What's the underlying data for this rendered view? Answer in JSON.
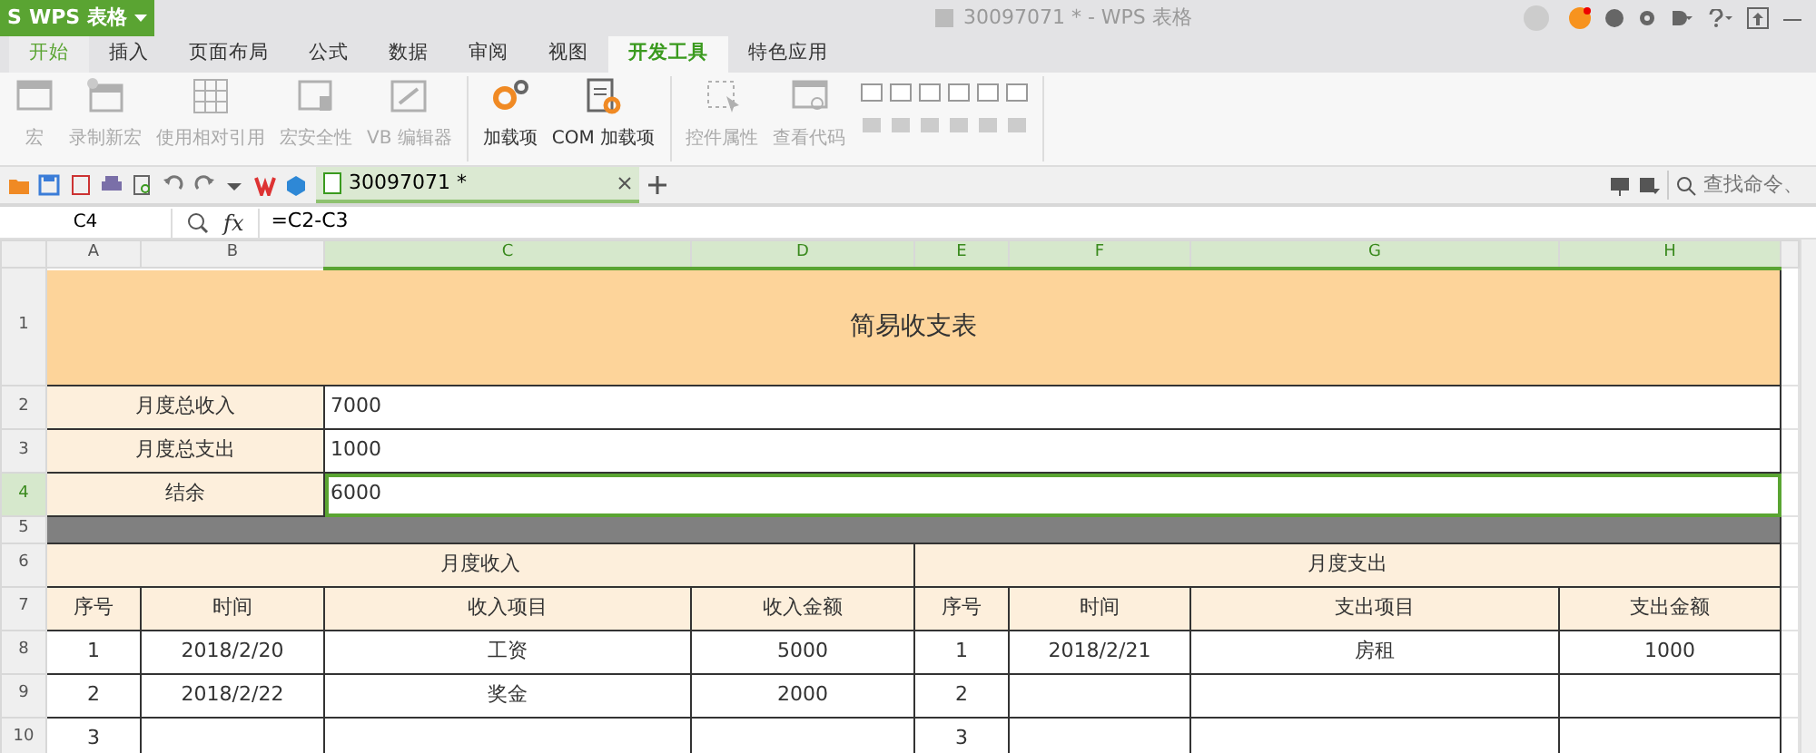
{
  "app": {
    "logo": "S",
    "name": "WPS 表格"
  },
  "window": {
    "title": "30097071 * - WPS 表格"
  },
  "menu_tabs": [
    {
      "label": "开始",
      "selected": false,
      "kind": "home"
    },
    {
      "label": "插入",
      "selected": false
    },
    {
      "label": "页面布局",
      "selected": false
    },
    {
      "label": "公式",
      "selected": false
    },
    {
      "label": "数据",
      "selected": false
    },
    {
      "label": "审阅",
      "selected": false
    },
    {
      "label": "视图",
      "selected": false
    },
    {
      "label": "开发工具",
      "selected": true
    },
    {
      "label": "特色应用",
      "selected": false
    }
  ],
  "ribbon": [
    {
      "label": "宏",
      "disabled": true,
      "kind": "window"
    },
    {
      "label": "录制新宏",
      "disabled": true,
      "kind": "record"
    },
    {
      "label": "使用相对引用",
      "disabled": true,
      "kind": "grid"
    },
    {
      "label": "宏安全性",
      "disabled": true,
      "kind": "shield"
    },
    {
      "label": "VB 编辑器",
      "disabled": true,
      "kind": "edit",
      "sep_after": true
    },
    {
      "label": "加载项",
      "disabled": false,
      "kind": "gears"
    },
    {
      "label": "COM 加载项",
      "disabled": false,
      "kind": "docgear",
      "sep_after": true
    },
    {
      "label": "控件属性",
      "disabled": true,
      "kind": "select"
    },
    {
      "label": "查看代码",
      "disabled": true,
      "kind": "code"
    }
  ],
  "document_tab": {
    "label": "30097071 *",
    "selected": true
  },
  "search": {
    "placeholder": "查找命令、"
  },
  "formula_bar": {
    "name_box": "C4",
    "fx": "fx",
    "formula": "=C2-C3"
  },
  "columns": [
    {
      "label": "A",
      "selected": false
    },
    {
      "label": "B",
      "selected": false
    },
    {
      "label": "C",
      "selected": true
    },
    {
      "label": "D",
      "selected": true
    },
    {
      "label": "E",
      "selected": true
    },
    {
      "label": "F",
      "selected": true
    },
    {
      "label": "G",
      "selected": true
    },
    {
      "label": "H",
      "selected": true
    }
  ],
  "rows": [
    {
      "number": "1",
      "selected": false,
      "kind": "tall",
      "cells": [
        {
          "text": "简易收支表",
          "kind": "title"
        }
      ]
    },
    {
      "number": "2",
      "selected": false,
      "cells": [
        {
          "text": "月度总收入",
          "kind": "label"
        },
        {
          "text": "7000",
          "kind": "value",
          "selected": false
        }
      ]
    },
    {
      "number": "3",
      "selected": false,
      "cells": [
        {
          "text": "月度总支出",
          "kind": "label"
        },
        {
          "text": "1000",
          "kind": "value",
          "selected": false
        }
      ]
    },
    {
      "number": "4",
      "selected": true,
      "cells": [
        {
          "text": "结余",
          "kind": "label"
        },
        {
          "text": "6000",
          "kind": "value",
          "selected": true
        }
      ]
    },
    {
      "number": "5",
      "selected": false,
      "kind": "short",
      "cells": [
        {
          "kind": "band"
        }
      ]
    },
    {
      "number": "6",
      "selected": false,
      "cells": [
        {
          "text": "月度收入",
          "kind": "group_header"
        },
        {
          "text": "月度支出",
          "kind": "group_header"
        }
      ]
    },
    {
      "number": "7",
      "selected": false,
      "cells": [
        {
          "text": "序号",
          "kind": "header"
        },
        {
          "text": "时间",
          "kind": "header"
        },
        {
          "text": "收入项目",
          "kind": "header"
        },
        {
          "text": "收入金额",
          "kind": "header"
        },
        {
          "text": "序号",
          "kind": "header"
        },
        {
          "text": "时间",
          "kind": "header"
        },
        {
          "text": "支出项目",
          "kind": "header"
        },
        {
          "text": "支出金额",
          "kind": "header"
        }
      ]
    },
    {
      "number": "8",
      "selected": false,
      "cells": [
        {
          "text": "1",
          "kind": "data"
        },
        {
          "text": "2018/2/20",
          "kind": "data"
        },
        {
          "text": "工资",
          "kind": "data"
        },
        {
          "text": "5000",
          "kind": "data"
        },
        {
          "text": "1",
          "kind": "data"
        },
        {
          "text": "2018/2/21",
          "kind": "data"
        },
        {
          "text": "房租",
          "kind": "data"
        },
        {
          "text": "1000",
          "kind": "data"
        }
      ]
    },
    {
      "number": "9",
      "selected": false,
      "cells": [
        {
          "text": "2",
          "kind": "data"
        },
        {
          "text": "2018/2/22",
          "kind": "data"
        },
        {
          "text": "奖金",
          "kind": "data"
        },
        {
          "text": "2000",
          "kind": "data"
        },
        {
          "text": "2",
          "kind": "data"
        },
        {
          "kind": "data"
        },
        {
          "kind": "data"
        },
        {
          "kind": "data"
        }
      ]
    },
    {
      "number": "10",
      "selected": false,
      "cells": [
        {
          "text": "3",
          "kind": "data"
        },
        {
          "kind": "data"
        },
        {
          "kind": "data"
        },
        {
          "kind": "data"
        },
        {
          "text": "3",
          "kind": "data"
        },
        {
          "kind": "data"
        },
        {
          "kind": "data"
        },
        {
          "kind": "data"
        }
      ]
    }
  ]
}
